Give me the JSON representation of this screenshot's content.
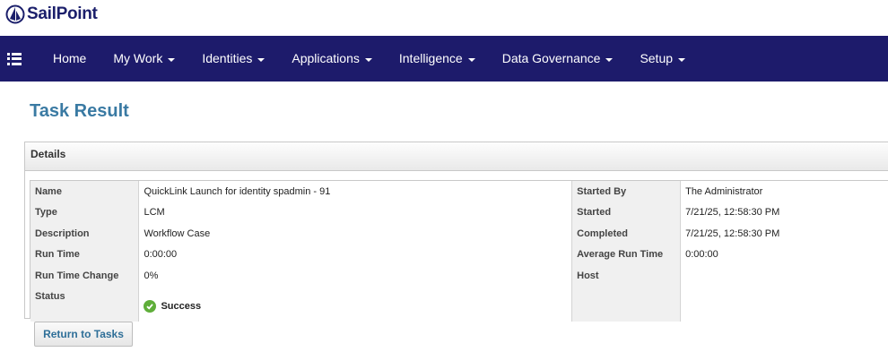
{
  "brand": {
    "name": "SailPoint"
  },
  "nav": {
    "items": [
      {
        "label": "Home",
        "dropdown": false
      },
      {
        "label": "My Work",
        "dropdown": true
      },
      {
        "label": "Identities",
        "dropdown": true
      },
      {
        "label": "Applications",
        "dropdown": true
      },
      {
        "label": "Intelligence",
        "dropdown": true
      },
      {
        "label": "Data Governance",
        "dropdown": true
      },
      {
        "label": "Setup",
        "dropdown": true
      }
    ]
  },
  "page": {
    "title": "Task Result"
  },
  "details": {
    "header": "Details",
    "rows": [
      {
        "l1": "Name",
        "v1": "QuickLink Launch for identity spadmin - 91",
        "l2": "Started By",
        "v2": "The Administrator"
      },
      {
        "l1": "Type",
        "v1": "LCM",
        "l2": "Started",
        "v2": "7/21/25, 12:58:30 PM"
      },
      {
        "l1": "Description",
        "v1": "Workflow Case",
        "l2": "Completed",
        "v2": "7/21/25, 12:58:30 PM"
      },
      {
        "l1": "Run Time",
        "v1": "0:00:00",
        "l2": "Average Run Time",
        "v2": "0:00:00"
      },
      {
        "l1": "Run Time Change",
        "v1": "0%",
        "l2": "Host",
        "v2": ""
      }
    ],
    "status": {
      "label": "Status",
      "value": "Success",
      "icon": "check-circle-icon",
      "color": "#5fae3a"
    }
  },
  "actions": {
    "return_label": "Return to Tasks"
  },
  "colors": {
    "nav_bg": "#1d1b6b",
    "title": "#3a7aa3",
    "brand": "#1b1f6b"
  }
}
